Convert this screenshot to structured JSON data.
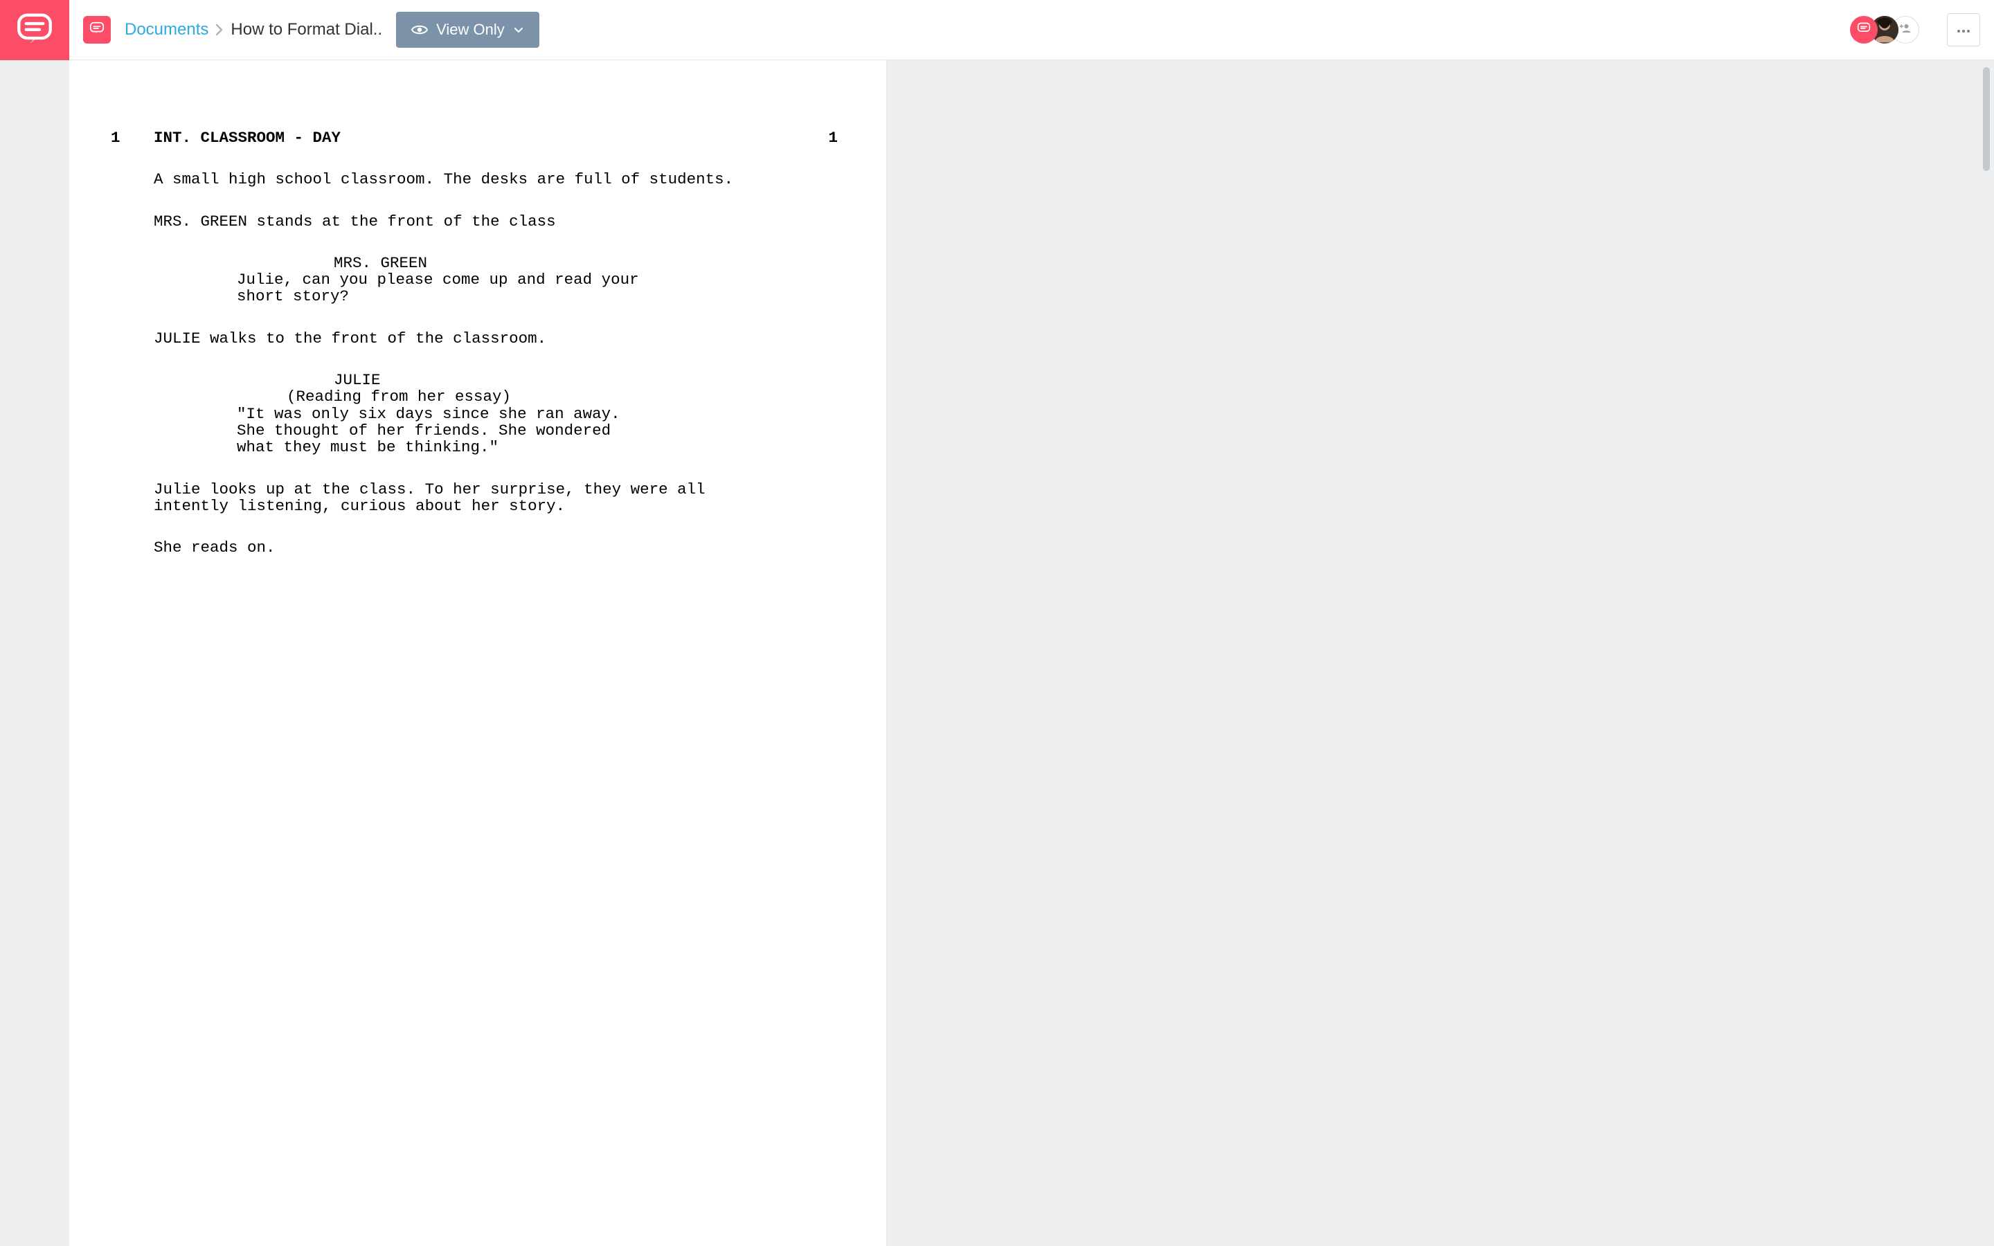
{
  "brand": {
    "name": "studiobinder-logo"
  },
  "breadcrumb": {
    "root": "Documents",
    "current": "How to Format Dial.."
  },
  "viewMode": {
    "label": "View Only"
  },
  "presence": {
    "p1": "chat-icon",
    "p2": "avatar-user",
    "p3": "add-user-icon"
  },
  "script": {
    "sceneNumber": "1",
    "sceneHeading": "INT. CLASSROOM - DAY",
    "action1": "A small high school classroom. The desks are full of students.",
    "action2": "MRS. GREEN stands at the front of the class",
    "cue1": {
      "character": "MRS. GREEN",
      "dialog": "Julie, can you please come up and read your short story?"
    },
    "action3": "JULIE walks to the front of the classroom.",
    "cue2": {
      "character": "JULIE",
      "paren": "(Reading from her essay)",
      "dialog": "\"It was only six days since she ran away. She thought of her friends. She wondered what they must be thinking.\""
    },
    "action4": "Julie looks up at the class. To her surprise, they were all intently listening, curious about her story.",
    "action5": "She reads on."
  }
}
